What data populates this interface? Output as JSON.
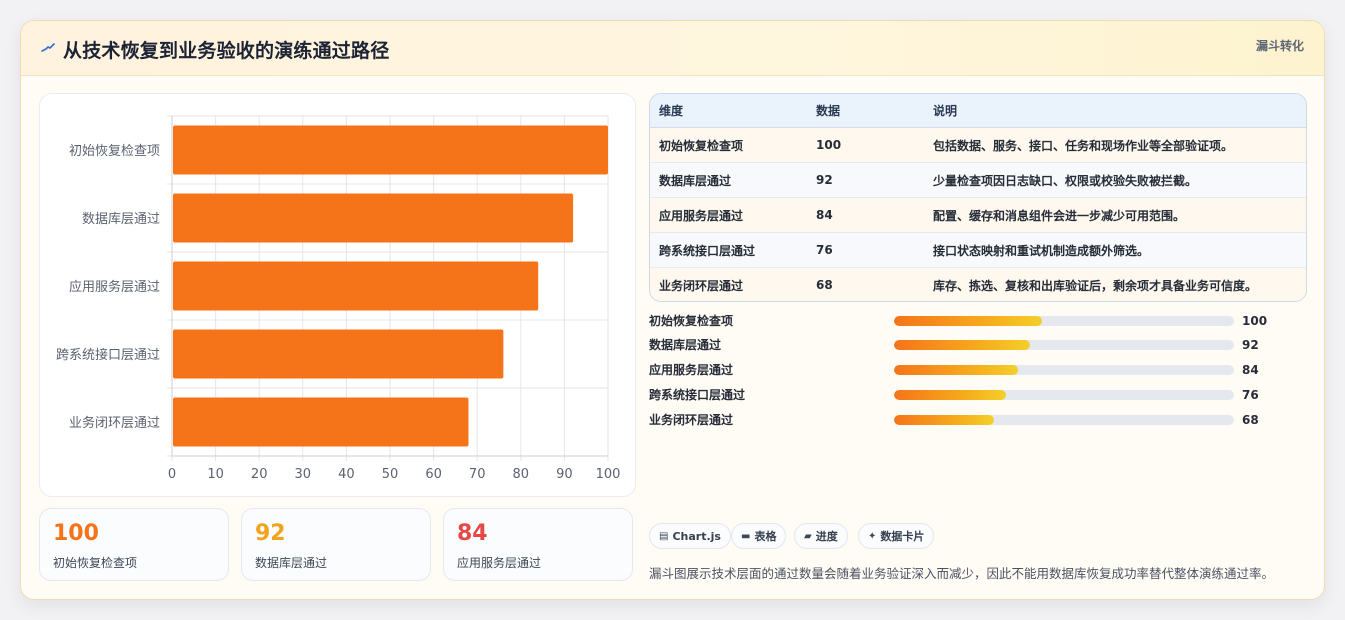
{
  "header": {
    "title": "从技术恢复到业务验收的演练通过路径",
    "tag": "漏斗转化",
    "icon": "pulse-icon"
  },
  "chart_data": {
    "type": "bar",
    "orientation": "horizontal",
    "categories": [
      "初始恢复检查项",
      "数据库层通过",
      "应用服务层通过",
      "跨系统接口层通过",
      "业务闭环层通过"
    ],
    "values": [
      100,
      92,
      84,
      76,
      68
    ],
    "xlim": [
      0,
      100
    ],
    "xticks": [
      0,
      10,
      20,
      30,
      40,
      50,
      60,
      70,
      80,
      90,
      100
    ],
    "grid": true,
    "bar_color": "#f5741a"
  },
  "stats": [
    {
      "value": "100",
      "label": "初始恢复检查项",
      "color": "#f5741a"
    },
    {
      "value": "92",
      "label": "数据库层通过",
      "color": "#f0a31c"
    },
    {
      "value": "84",
      "label": "应用服务层通过",
      "color": "#e64848"
    }
  ],
  "table": {
    "headers": [
      "维度",
      "数据",
      "说明"
    ],
    "rows": [
      {
        "dim": "初始恢复检查项",
        "value": "100",
        "desc": "包括数据、服务、接口、任务和现场作业等全部验证项。"
      },
      {
        "dim": "数据库层通过",
        "value": "92",
        "desc": "少量检查项因日志缺口、权限或校验失败被拦截。"
      },
      {
        "dim": "应用服务层通过",
        "value": "84",
        "desc": "配置、缓存和消息组件会进一步减少可用范围。"
      },
      {
        "dim": "跨系统接口层通过",
        "value": "76",
        "desc": "接口状态映射和重试机制造成额外筛选。"
      },
      {
        "dim": "业务闭环层通过",
        "value": "68",
        "desc": "库存、拣选、复核和出库验证后，剩余项才具备业务可信度。"
      }
    ]
  },
  "progress": [
    {
      "label": "初始恢复检查项",
      "value": "100",
      "fraction": 0.435
    },
    {
      "label": "数据库层通过",
      "value": "92",
      "fraction": 0.4
    },
    {
      "label": "应用服务层通过",
      "value": "84",
      "fraction": 0.365
    },
    {
      "label": "跨系统接口层通过",
      "value": "76",
      "fraction": 0.33
    },
    {
      "label": "业务闭环层通过",
      "value": "68",
      "fraction": 0.295
    }
  ],
  "chips": [
    {
      "label": "Chart.js",
      "icon": "chart-icon"
    },
    {
      "label": "表格",
      "icon": "table-icon"
    },
    {
      "label": "进度",
      "icon": "progress-icon"
    },
    {
      "label": "数据卡片",
      "icon": "sparkle-icon"
    }
  ],
  "note": "漏斗图展示技术层面的通过数量会随着业务验证深入而减少，因此不能用数据库恢复成功率替代整体演练通过率。"
}
